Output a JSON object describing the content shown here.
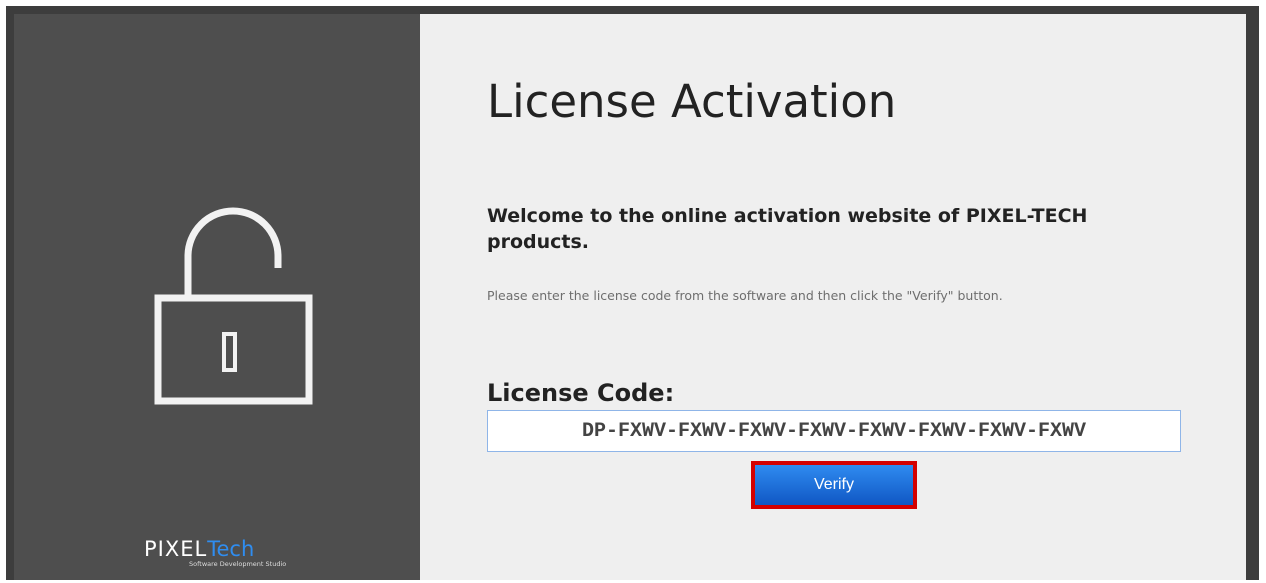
{
  "page": {
    "title": "License Activation",
    "welcome": "Welcome to the online activation website of PIXEL-TECH products.",
    "instructions": "Please enter the license code from the software and then click the \"Verify\" button."
  },
  "form": {
    "code_label": "License Code:",
    "code_value": "DP-FXWV-FXWV-FXWV-FXWV-FXWV-FXWV-FXWV-FXWV",
    "verify_label": "Verify"
  },
  "brand": {
    "logo_main": "PIXEL",
    "logo_accent": "Tech",
    "logo_sub": "Software Development Studio"
  },
  "icons": {
    "lock": "unlocked-padlock-icon"
  },
  "colors": {
    "left_panel": "#4e4e4e",
    "right_panel": "#efefef",
    "accent_blue": "#1a6fe0",
    "highlight_red": "#d40000",
    "logo_accent": "#2f8df0"
  }
}
